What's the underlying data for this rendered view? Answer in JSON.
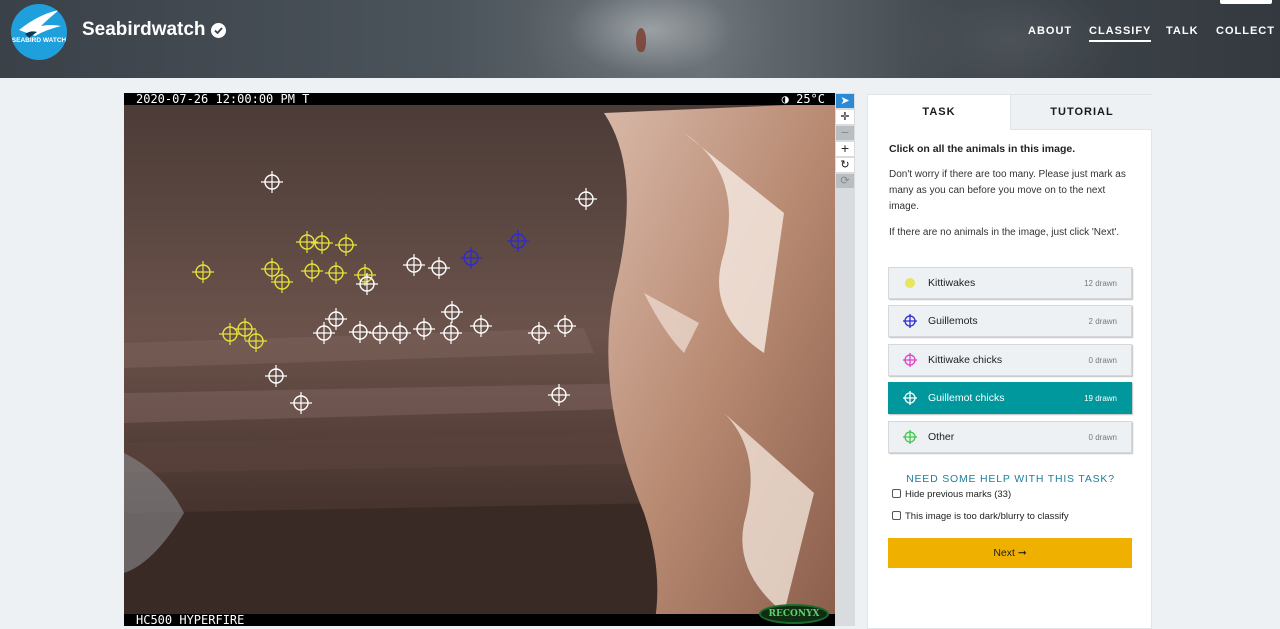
{
  "header": {
    "logo_text": "SEABIRD WATCH",
    "title": "Seabirdwatch",
    "nav": [
      {
        "label": "ABOUT",
        "active": false
      },
      {
        "label": "CLASSIFY",
        "active": true
      },
      {
        "label": "TALK",
        "active": false
      },
      {
        "label": "COLLECT",
        "active": false
      }
    ]
  },
  "camera": {
    "top_left": "2020-07-26 12:00:00 PM  T",
    "top_right": "◑  25°C",
    "bottom_left": "HC500 HYPERFIRE",
    "brand": "RECONYX"
  },
  "tools": [
    {
      "icon": "pointer-icon",
      "glyph": "➤"
    },
    {
      "icon": "move-icon",
      "glyph": "✛"
    },
    {
      "icon": "zoom-out-icon",
      "glyph": "−"
    },
    {
      "icon": "zoom-in-icon",
      "glyph": "+"
    },
    {
      "icon": "rotate-icon",
      "glyph": "↻"
    },
    {
      "icon": "reset-icon",
      "glyph": "⟳"
    }
  ],
  "panel": {
    "tabs": [
      "TASK",
      "TUTORIAL"
    ],
    "instruction_title": "Click on all the animals in this image.",
    "instruction_1": "Don't worry if there are too many. Please just mark as many as you can before you move on to the next image.",
    "instruction_2": "If there are no animals in the image, just click 'Next'.",
    "choices": [
      {
        "label": "Kittiwakes",
        "count": "12 drawn",
        "color": "#e6e23a",
        "icon": "circle-icon"
      },
      {
        "label": "Guillemots",
        "count": "2 drawn",
        "color": "#2b2bd0",
        "icon": "crosshair-icon"
      },
      {
        "label": "Kittiwake chicks",
        "count": "0 drawn",
        "color": "#e040c8",
        "icon": "crosshair-icon"
      },
      {
        "label": "Guillemot chicks",
        "count": "19 drawn",
        "color": "#ffffff",
        "icon": "crosshair-icon"
      },
      {
        "label": "Other",
        "count": "0 drawn",
        "color": "#3cc84a",
        "icon": "crosshair-icon"
      }
    ],
    "help": "NEED SOME HELP WITH THIS TASK?",
    "hide_marks": "Hide previous marks (33)",
    "too_dark": "This image is too dark/blurry to classify",
    "next": "Next ➞"
  },
  "colors": {
    "accent_teal": "#00979d",
    "next_yellow": "#f0b000",
    "kittiwake_yellow": "#e6e23a",
    "guillemot_blue": "#2b2bd0",
    "chick_white": "#ffffff"
  }
}
